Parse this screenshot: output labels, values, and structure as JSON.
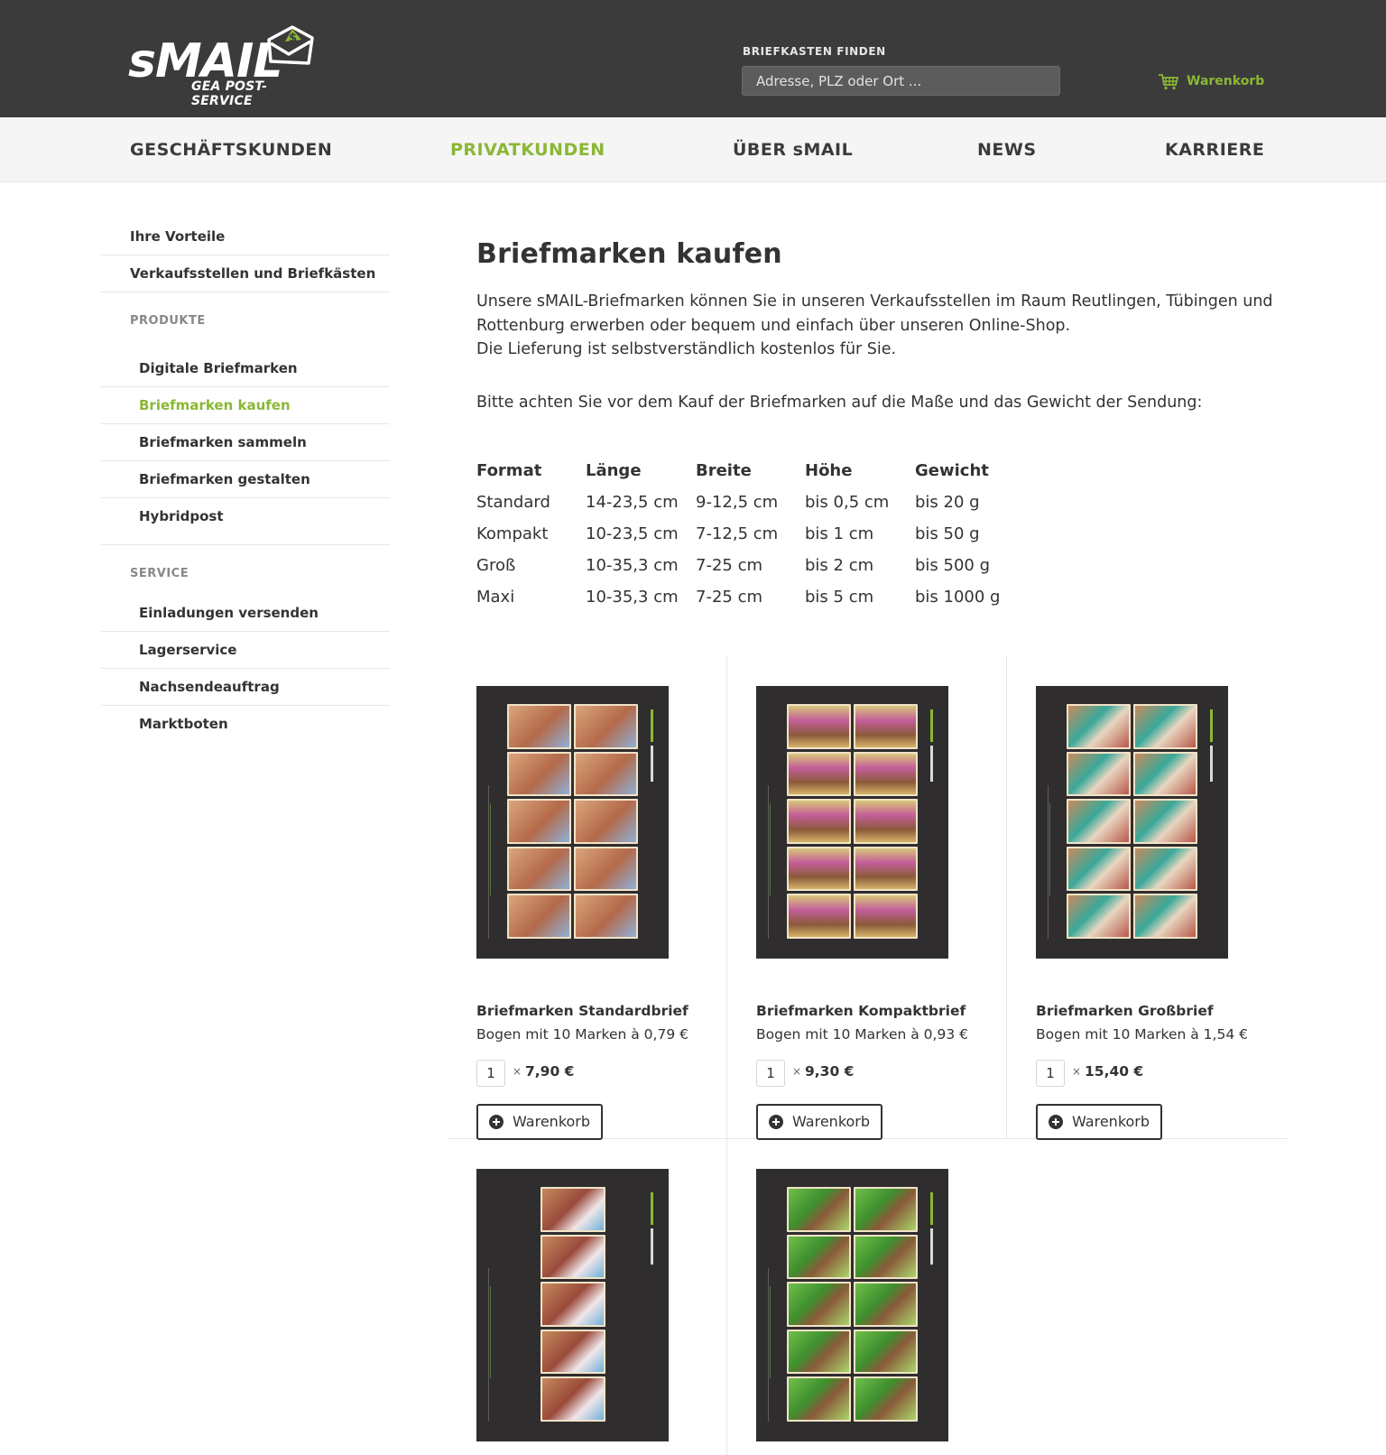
{
  "header": {
    "logo_text": "sMAIL",
    "logo_subtitle": "GEA POST-SERVICE",
    "finder_label": "BRIEFKASTEN FINDEN",
    "finder_placeholder": "Adresse, PLZ oder Ort ...",
    "cart_label": "Warenkorb"
  },
  "nav": {
    "items": [
      {
        "label": "GESCHÄFTSKUNDEN",
        "active": false
      },
      {
        "label": "PRIVATKUNDEN",
        "active": true
      },
      {
        "label": "ÜBER sMAIL",
        "active": false
      },
      {
        "label": "NEWS",
        "active": false
      },
      {
        "label": "KARRIERE",
        "active": false
      }
    ]
  },
  "sidebar": {
    "top_items": [
      "Ihre Vorteile",
      "Verkaufsstellen und Briefkästen"
    ],
    "products_heading": "PRODUKTE",
    "products": [
      "Digitale Briefmarken",
      "Briefmarken kaufen",
      "Briefmarken sammeln",
      "Briefmarken gestalten",
      "Hybridpost"
    ],
    "active_product": "Briefmarken kaufen",
    "service_heading": "SERVICE",
    "service": [
      "Einladungen versenden",
      "Lagerservice",
      "Nachsendeauftrag",
      "Marktboten"
    ]
  },
  "content": {
    "title": "Briefmarken kaufen",
    "intro_line1": "Unsere sMAIL-Briefmarken können Sie in unseren Verkaufsstellen im Raum Reutlingen, Tübingen und Rottenburg erwerben oder bequem und einfach über unseren Online-Shop.",
    "intro_line2": "Die Lieferung ist selbstverständlich kostenlos für Sie.",
    "note": "Bitte achten Sie vor dem Kauf der Briefmarken auf die Maße und das Gewicht der Sendung:",
    "table": {
      "headers": [
        "Format",
        "Länge",
        "Breite",
        "Höhe",
        "Gewicht"
      ],
      "rows": [
        [
          "Standard",
          "14-23,5 cm",
          "9-12,5 cm",
          "bis 0,5 cm",
          "bis 20 g"
        ],
        [
          "Kompakt",
          "10-23,5 cm",
          "7-12,5 cm",
          "bis 1 cm",
          "bis 50 g"
        ],
        [
          "Groß",
          "10-35,3 cm",
          "7-25 cm",
          "bis 2 cm",
          "bis 500 g"
        ],
        [
          "Maxi",
          "10-35,3 cm",
          "7-25 cm",
          "bis 5 cm",
          "bis 1000 g"
        ]
      ]
    }
  },
  "products": [
    {
      "title": "Briefmarken Standardbrief",
      "desc": "Bogen mit 10 Marken à 0,79 €",
      "qty": "1",
      "times": "×",
      "price": "7,90 €",
      "button": "Warenkorb"
    },
    {
      "title": "Briefmarken Kompaktbrief",
      "desc": "Bogen mit 10 Marken à 0,93 €",
      "qty": "1",
      "times": "×",
      "price": "9,30 €",
      "button": "Warenkorb"
    },
    {
      "title": "Briefmarken Großbrief",
      "desc": "Bogen mit 10 Marken à 1,54 €",
      "qty": "1",
      "times": "×",
      "price": "15,40 €",
      "button": "Warenkorb"
    }
  ],
  "colors": {
    "header_bg": "#3b3b3c",
    "accent_green": "#8ab833",
    "nav_bg": "#f5f5f5",
    "sheet_bg": "#2f2d2e"
  },
  "icons": {
    "cart": "shopping-cart-icon",
    "logo_envelope": "envelope-dollar-icon",
    "add": "plus-circle-icon"
  }
}
